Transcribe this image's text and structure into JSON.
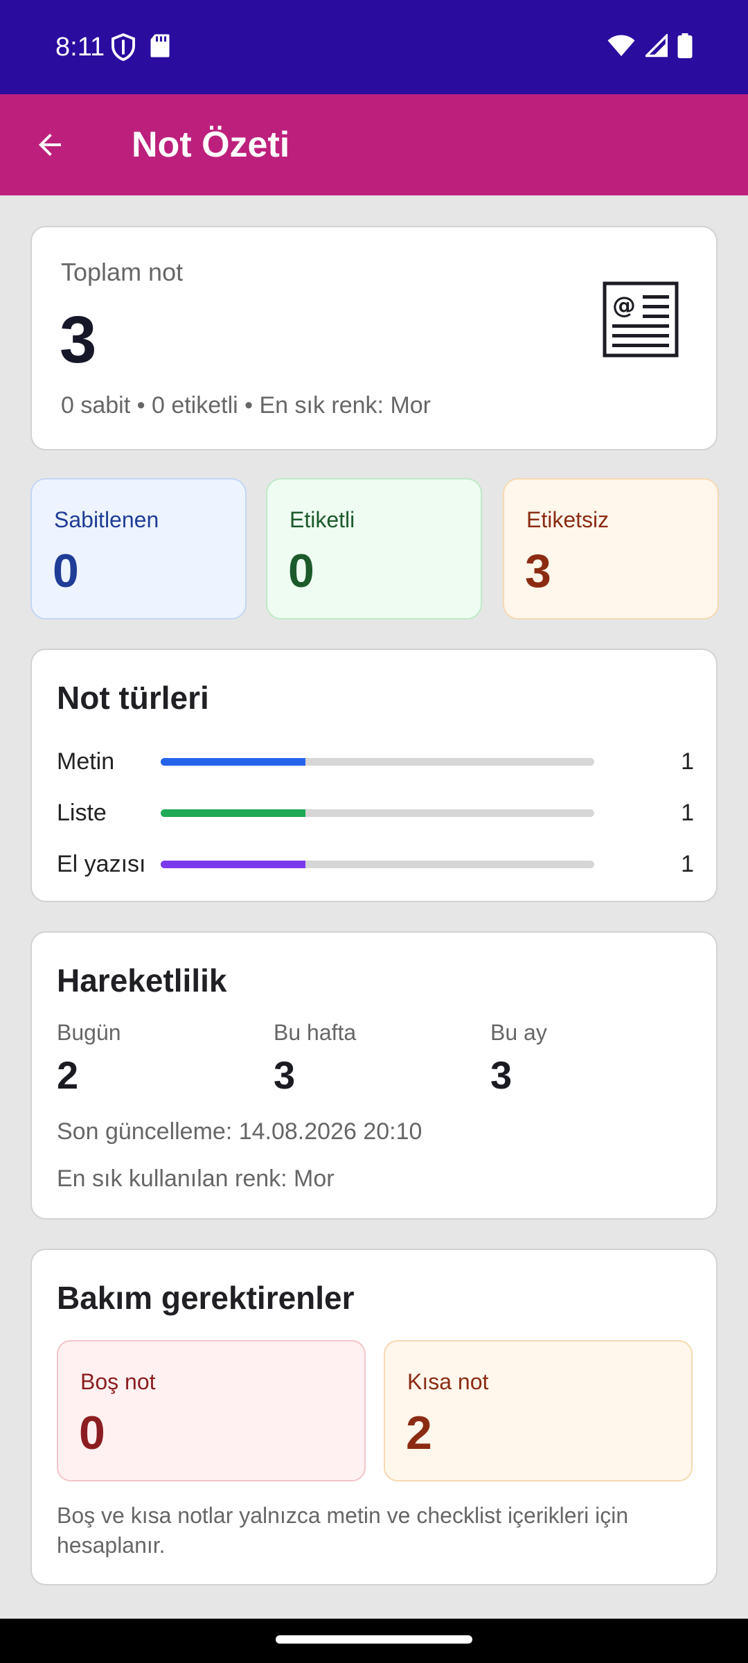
{
  "status_bar": {
    "time": "8:11",
    "left_icons": [
      "shield-icon",
      "sd-card-icon"
    ],
    "right_icons": [
      "wifi-icon",
      "signal-icon",
      "battery-icon"
    ]
  },
  "app_bar": {
    "title": "Not Özeti",
    "back_icon": "arrow-back-icon",
    "background": "#bd207c"
  },
  "summary": {
    "label": "Toplam not",
    "value": "3",
    "subtitle": "0 sabit • 0 etiketli • En sık renk: Mor",
    "icon": "newspaper-at-icon"
  },
  "stats": [
    {
      "label": "Sabitlenen",
      "value": "0"
    },
    {
      "label": "Etiketli",
      "value": "0"
    },
    {
      "label": "Etiketsiz",
      "value": "3"
    }
  ],
  "note_types": {
    "title": "Not türleri",
    "items": [
      {
        "name": "Metin",
        "count": "1",
        "fraction": 0.3333,
        "color": "#2563eb"
      },
      {
        "name": "Liste",
        "count": "1",
        "fraction": 0.3333,
        "color": "#1faa55"
      },
      {
        "name": "El yazısı",
        "count": "1",
        "fraction": 0.3333,
        "color": "#7c3aed"
      }
    ]
  },
  "activity": {
    "title": "Hareketlilik",
    "columns": [
      {
        "label": "Bugün",
        "value": "2"
      },
      {
        "label": "Bu hafta",
        "value": "3"
      },
      {
        "label": "Bu ay",
        "value": "3"
      }
    ],
    "last_update": "Son güncelleme: 14.08.2026 20:10",
    "most_used_color": "En sık kullanılan renk: Mor"
  },
  "maintenance": {
    "title": "Bakım gerektirenler",
    "boxes": [
      {
        "label": "Boş not",
        "value": "0"
      },
      {
        "label": "Kısa not",
        "value": "2"
      }
    ],
    "note": "Boş ve kısa notlar yalnızca metin ve checklist içerikleri için hesaplanır."
  }
}
